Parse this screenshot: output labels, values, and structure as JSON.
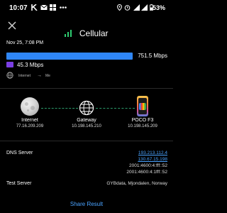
{
  "status_bar": {
    "time": "10:07",
    "battery": "53%"
  },
  "header": {
    "title": "Cellular"
  },
  "result": {
    "date": "Nov 25, 7:08 PM",
    "download": "751.5 Mbps",
    "upload": "45.3 Mbps",
    "legend_from": "Internet",
    "legend_arrow": "→",
    "legend_to": "Me"
  },
  "route": {
    "nodes": [
      {
        "name": "Internet",
        "ip": "77.16.209.209"
      },
      {
        "name": "Gateway",
        "ip": "10.198.145.210"
      },
      {
        "name": "POCO F3",
        "ip": "10.198.145.209"
      }
    ]
  },
  "info": {
    "dns_label": "DNS Server",
    "dns_servers": [
      "193.213.112.4",
      "130.67.15.198",
      "2001:4600:4:fff::52",
      "2001:4600:4:1fff::52"
    ],
    "test_server_label": "Test Server",
    "test_server": "GYBdata, Mjondalen, Norway"
  },
  "footer": {
    "share_label": "Share Result"
  },
  "colors": {
    "download": "#2f86f6",
    "upload": "#7b3fe4",
    "link": "#4aa3ff",
    "accent": "#2ecc71"
  }
}
